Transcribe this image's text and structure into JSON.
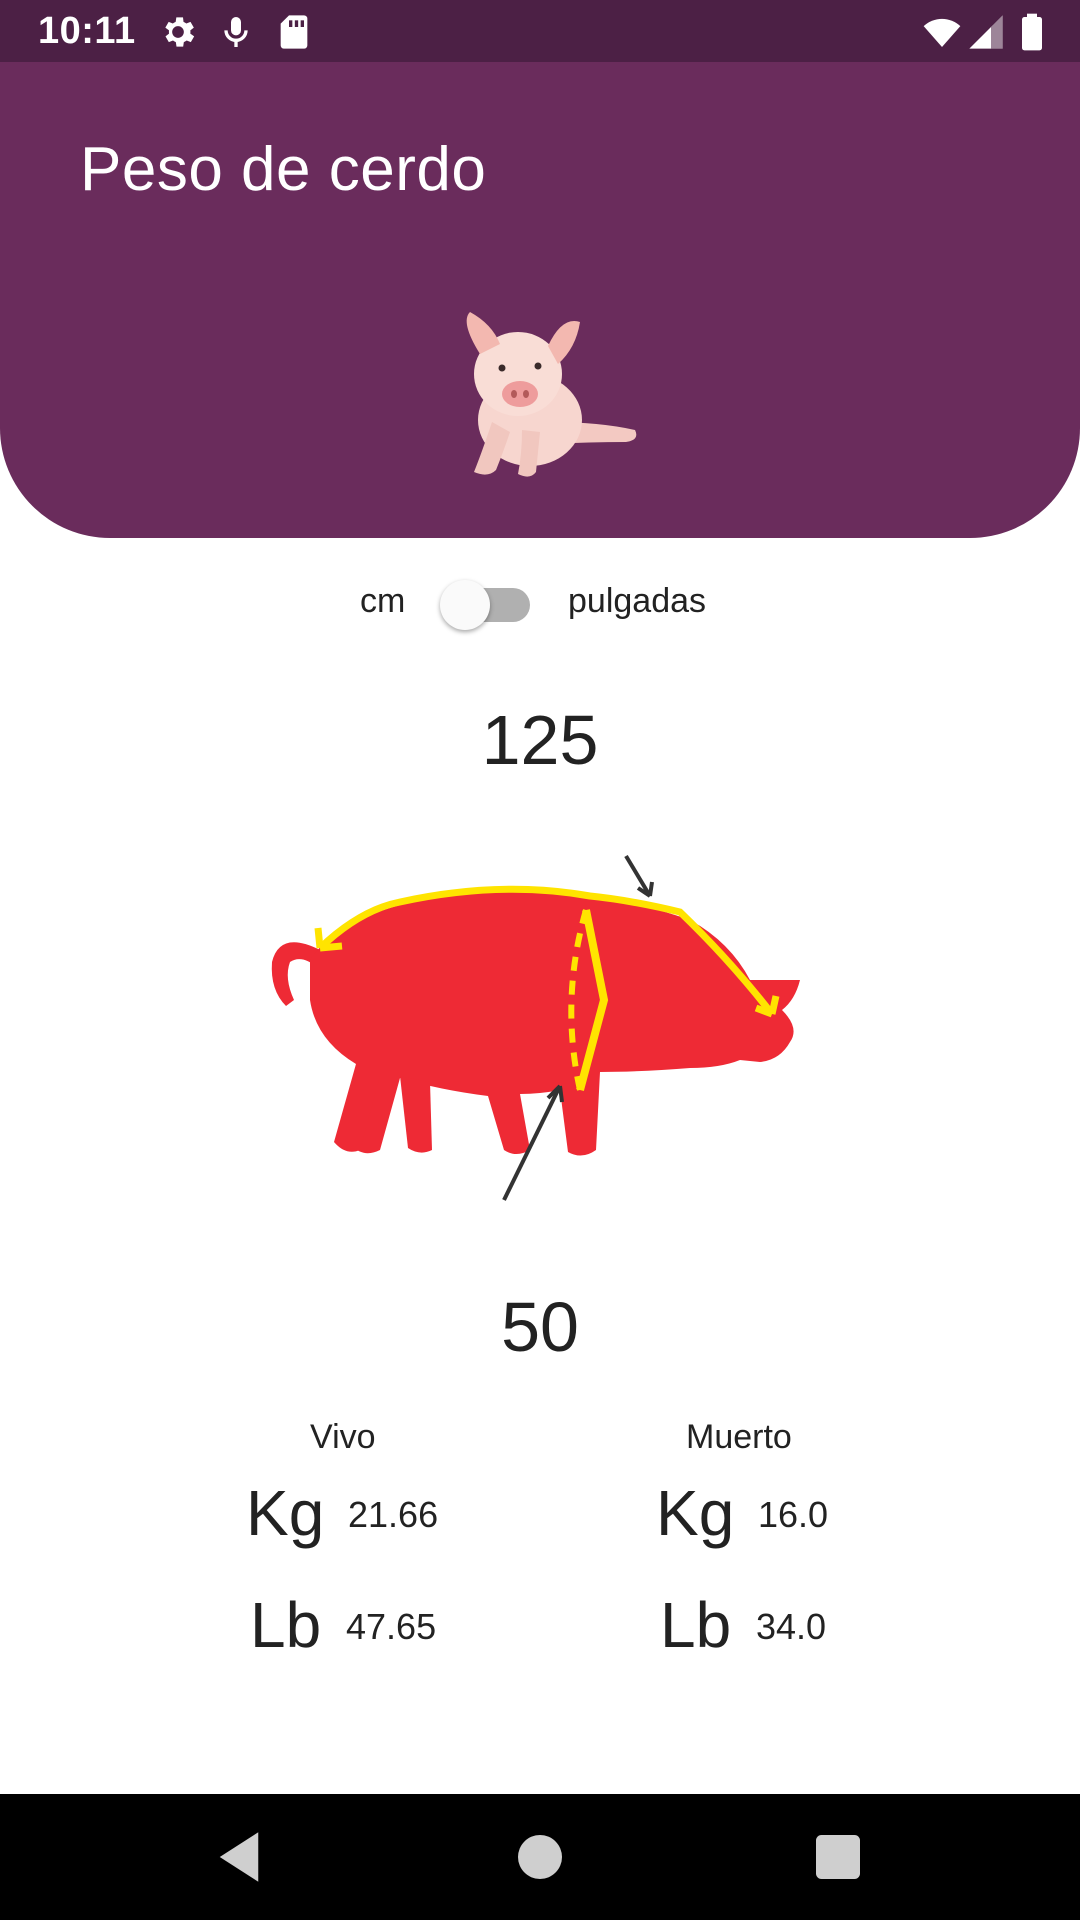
{
  "status_bar": {
    "time": "10:11",
    "icons_left": [
      "gear-icon",
      "mic-icon",
      "sd-card-icon"
    ],
    "icons_right": [
      "wifi-icon",
      "signal-icon",
      "battery-icon"
    ]
  },
  "header": {
    "title": "Peso de cerdo",
    "image": "piglet-image"
  },
  "unit_switch": {
    "left_label": "cm",
    "right_label": "pulgadas",
    "checked": false
  },
  "measurements": {
    "length": "125",
    "girth": "50"
  },
  "results": {
    "alive": {
      "title": "Vivo",
      "kg_label": "Kg",
      "kg_value": "21.66",
      "lb_label": "Lb",
      "lb_value": "47.65"
    },
    "dead": {
      "title": "Muerto",
      "kg_label": "Kg",
      "kg_value": "16.0",
      "lb_label": "Lb",
      "lb_value": "34.0"
    }
  },
  "colors": {
    "status_bar": "#4c2045",
    "header": "#6a2c5c",
    "pig_red": "#ee2a35",
    "measure_yellow": "#ffe400"
  },
  "nav_bar": {
    "icons": [
      "back-icon",
      "home-icon",
      "recents-icon"
    ]
  }
}
